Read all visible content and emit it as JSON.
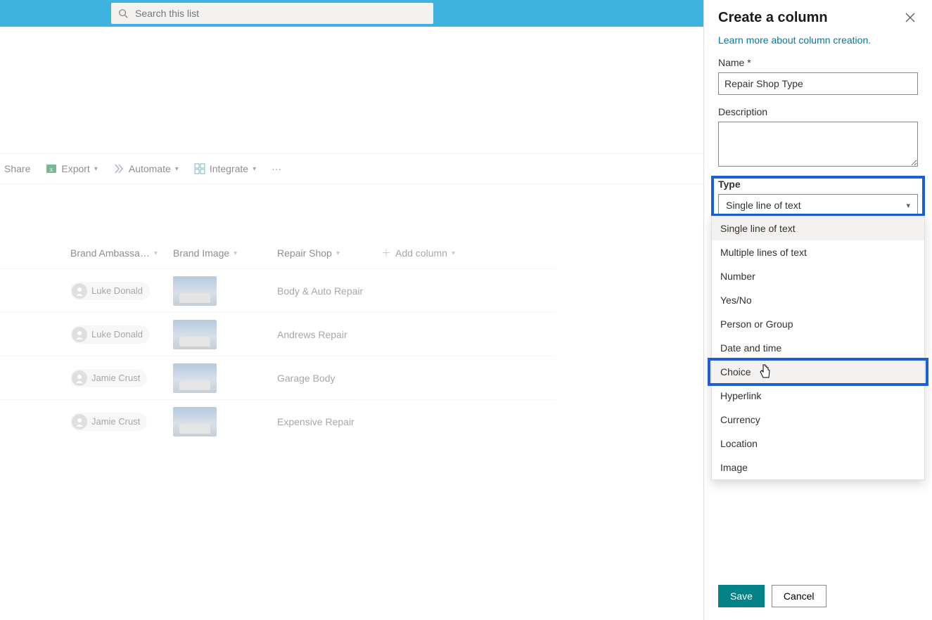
{
  "search": {
    "placeholder": "Search this list"
  },
  "commandbar": {
    "share": "Share",
    "export": "Export",
    "automate": "Automate",
    "integrate": "Integrate"
  },
  "list": {
    "columns": {
      "ambassador": "Brand Ambassa…",
      "image": "Brand Image",
      "shop": "Repair Shop",
      "add": "Add column"
    },
    "rows": [
      {
        "person": "Luke Donald",
        "shop": "Body & Auto Repair"
      },
      {
        "person": "Luke Donald",
        "shop": "Andrews Repair"
      },
      {
        "person": "Jamie Crust",
        "shop": "Garage Body"
      },
      {
        "person": "Jamie Crust",
        "shop": "Expensive Repair"
      }
    ]
  },
  "pane": {
    "title": "Create a column",
    "learn": "Learn more about column creation.",
    "name_label": "Name *",
    "name_value": "Repair Shop Type",
    "desc_label": "Description",
    "desc_value": "",
    "type_label": "Type",
    "type_selected": "Single line of text",
    "type_options": [
      "Single line of text",
      "Multiple lines of text",
      "Number",
      "Yes/No",
      "Person or Group",
      "Date and time",
      "Choice",
      "Hyperlink",
      "Currency",
      "Location",
      "Image"
    ],
    "save": "Save",
    "cancel": "Cancel"
  }
}
